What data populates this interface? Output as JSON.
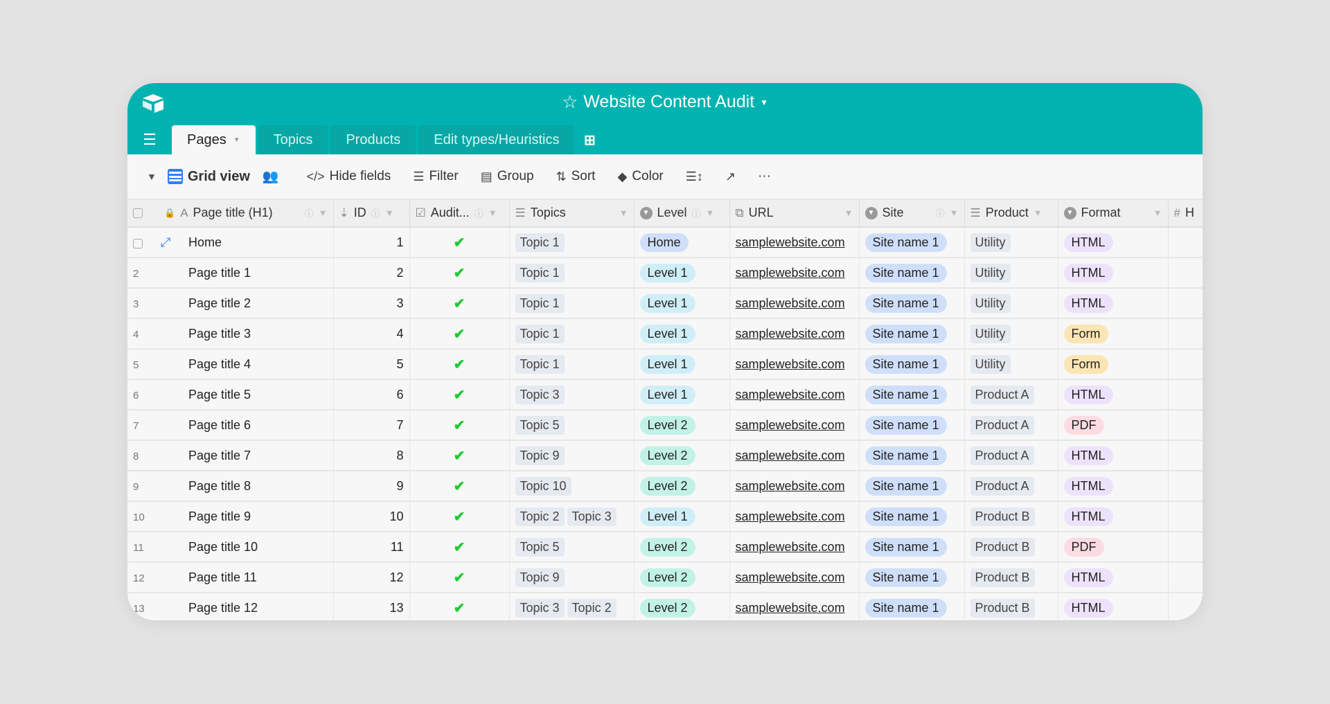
{
  "app": {
    "title": "Website Content Audit",
    "brand_color": "#00b3b0"
  },
  "tabs": [
    {
      "label": "Pages",
      "active": true
    },
    {
      "label": "Topics"
    },
    {
      "label": "Products"
    },
    {
      "label": "Edit types/Heuristics"
    }
  ],
  "toolbar": {
    "view_name": "Grid view",
    "hide_fields": "Hide fields",
    "filter": "Filter",
    "group": "Group",
    "sort": "Sort",
    "color": "Color",
    "more": "···"
  },
  "columns": {
    "title": "Page title (H1)",
    "id": "ID",
    "audit": "Audit...",
    "topics": "Topics",
    "level": "Level",
    "url": "URL",
    "site": "Site",
    "product": "Product",
    "format": "Format",
    "h": "H"
  },
  "colors": {
    "Home": "#cfdffa",
    "Level 1": "#d0eef7",
    "Level 2": "#c2f2e6",
    "Site name 1": "#cfdffa",
    "HTML": "#ede2fb",
    "Form": "#fbe5b4",
    "PDF": "#fddbe3"
  },
  "rows": [
    {
      "num": "",
      "title": "Home",
      "id": "1",
      "audited": true,
      "topics": [
        "Topic 1"
      ],
      "level": "Home",
      "url": "samplewebsite.com",
      "site": "Site name 1",
      "product": "Utility",
      "format": "HTML"
    },
    {
      "num": "2",
      "title": "Page title 1",
      "id": "2",
      "audited": true,
      "topics": [
        "Topic 1"
      ],
      "level": "Level 1",
      "url": "samplewebsite.com",
      "site": "Site name 1",
      "product": "Utility",
      "format": "HTML"
    },
    {
      "num": "3",
      "title": "Page title 2",
      "id": "3",
      "audited": true,
      "topics": [
        "Topic 1"
      ],
      "level": "Level 1",
      "url": "samplewebsite.com",
      "site": "Site name 1",
      "product": "Utility",
      "format": "HTML"
    },
    {
      "num": "4",
      "title": "Page title 3",
      "id": "4",
      "audited": true,
      "topics": [
        "Topic 1"
      ],
      "level": "Level 1",
      "url": "samplewebsite.com",
      "site": "Site name 1",
      "product": "Utility",
      "format": "Form"
    },
    {
      "num": "5",
      "title": "Page title 4",
      "id": "5",
      "audited": true,
      "topics": [
        "Topic 1"
      ],
      "level": "Level 1",
      "url": "samplewebsite.com",
      "site": "Site name 1",
      "product": "Utility",
      "format": "Form"
    },
    {
      "num": "6",
      "title": "Page title 5",
      "id": "6",
      "audited": true,
      "topics": [
        "Topic 3"
      ],
      "level": "Level 1",
      "url": "samplewebsite.com",
      "site": "Site name 1",
      "product": "Product A",
      "format": "HTML"
    },
    {
      "num": "7",
      "title": "Page title 6",
      "id": "7",
      "audited": true,
      "topics": [
        "Topic 5"
      ],
      "level": "Level 2",
      "url": "samplewebsite.com",
      "site": "Site name 1",
      "product": "Product A",
      "format": "PDF"
    },
    {
      "num": "8",
      "title": "Page title 7",
      "id": "8",
      "audited": true,
      "topics": [
        "Topic 9"
      ],
      "level": "Level 2",
      "url": "samplewebsite.com",
      "site": "Site name 1",
      "product": "Product A",
      "format": "HTML"
    },
    {
      "num": "9",
      "title": "Page title 8",
      "id": "9",
      "audited": true,
      "topics": [
        "Topic 10"
      ],
      "level": "Level 2",
      "url": "samplewebsite.com",
      "site": "Site name 1",
      "product": "Product A",
      "format": "HTML"
    },
    {
      "num": "10",
      "title": "Page title 9",
      "id": "10",
      "audited": true,
      "topics": [
        "Topic 2",
        "Topic 3"
      ],
      "level": "Level 1",
      "url": "samplewebsite.com",
      "site": "Site name 1",
      "product": "Product B",
      "format": "HTML"
    },
    {
      "num": "11",
      "title": "Page title 10",
      "id": "11",
      "audited": true,
      "topics": [
        "Topic 5"
      ],
      "level": "Level 2",
      "url": "samplewebsite.com",
      "site": "Site name 1",
      "product": "Product B",
      "format": "PDF"
    },
    {
      "num": "12",
      "title": "Page title 11",
      "id": "12",
      "audited": true,
      "topics": [
        "Topic 9"
      ],
      "level": "Level 2",
      "url": "samplewebsite.com",
      "site": "Site name 1",
      "product": "Product B",
      "format": "HTML"
    },
    {
      "num": "13",
      "title": "Page title 12",
      "id": "13",
      "audited": true,
      "topics": [
        "Topic 3",
        "Topic 2"
      ],
      "level": "Level 2",
      "url": "samplewebsite.com",
      "site": "Site name 1",
      "product": "Product B",
      "format": "HTML"
    }
  ]
}
